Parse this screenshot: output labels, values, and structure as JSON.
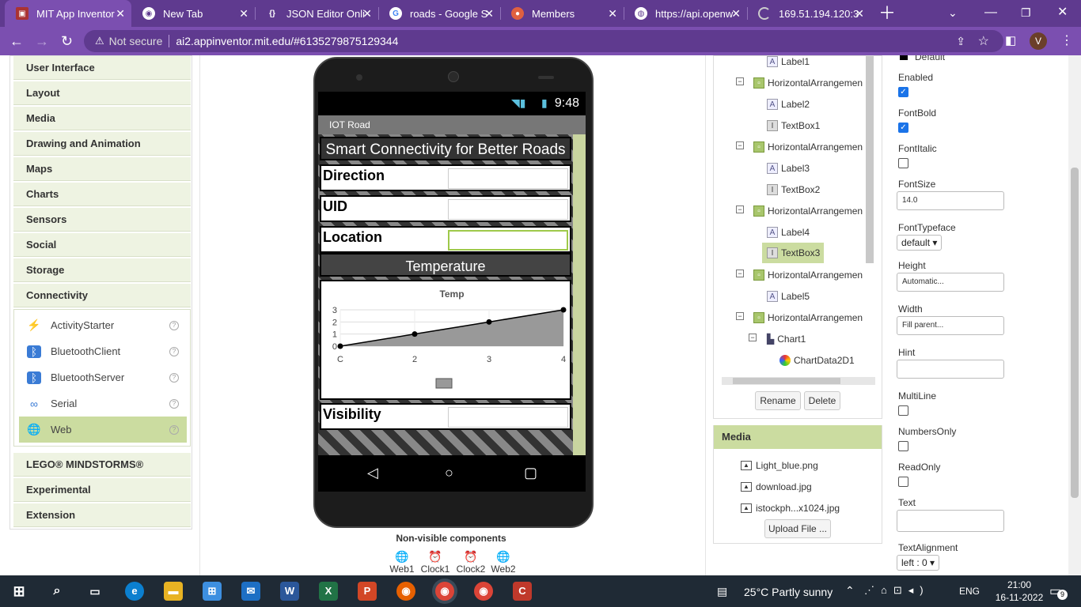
{
  "browser": {
    "tabs": [
      {
        "label": "MIT App Inventor",
        "active": true
      },
      {
        "label": "New Tab"
      },
      {
        "label": "JSON Editor Onli"
      },
      {
        "label": "roads - Google S"
      },
      {
        "label": "Members"
      },
      {
        "label": "https://api.openw"
      },
      {
        "label": "169.51.194.120:3"
      }
    ],
    "address": {
      "not_secure": "Not secure",
      "url": "ai2.appinventor.mit.edu/#6135279875129344"
    },
    "profile_initial": "V",
    "accent": "#7b4fb0"
  },
  "palette": {
    "categories": [
      "User Interface",
      "Layout",
      "Media",
      "Drawing and Animation",
      "Maps",
      "Charts",
      "Sensors",
      "Social",
      "Storage",
      "Connectivity"
    ],
    "connectivity_items": [
      "ActivityStarter",
      "BluetoothClient",
      "BluetoothServer",
      "Serial",
      "Web"
    ],
    "bottom_categories": [
      "LEGO® MINDSTORMS®",
      "Experimental",
      "Extension"
    ]
  },
  "phone": {
    "status_time": "9:48",
    "screen_title": "IOT Road",
    "app_title": "Smart Connectivity for Better Roads",
    "labels": {
      "direction": "Direction",
      "uid": "UID",
      "location": "Location",
      "temperature": "Temperature",
      "visibility": "Visibility"
    }
  },
  "chart_data": {
    "type": "area",
    "title": "Temp",
    "x": [
      "C",
      "2",
      "3",
      "4"
    ],
    "values": [
      0,
      1,
      2,
      3
    ],
    "yticks": [
      "0",
      "1",
      "2",
      "3"
    ],
    "ylim": [
      0,
      3
    ],
    "grid": true,
    "fill": "#999999"
  },
  "nonvisible": {
    "title": "Non-visible components",
    "items": [
      "Web1",
      "Clock1",
      "Clock2",
      "Web2"
    ]
  },
  "tree": {
    "nodes": [
      {
        "label": "Label1"
      },
      {
        "label": "HorizontalArrangemen"
      },
      {
        "label": "Label2"
      },
      {
        "label": "TextBox1"
      },
      {
        "label": "HorizontalArrangemen"
      },
      {
        "label": "Label3"
      },
      {
        "label": "TextBox2"
      },
      {
        "label": "HorizontalArrangemen"
      },
      {
        "label": "Label4"
      },
      {
        "label": "TextBox3"
      },
      {
        "label": "HorizontalArrangemen"
      },
      {
        "label": "Label5"
      },
      {
        "label": "HorizontalArrangemen"
      },
      {
        "label": "Chart1"
      },
      {
        "label": "ChartData2D1"
      }
    ],
    "rename": "Rename",
    "delete": "Delete"
  },
  "media": {
    "title": "Media",
    "files": [
      "Light_blue.png",
      "download.jpg",
      "istockph...x1024.jpg"
    ],
    "upload": "Upload File ..."
  },
  "properties": {
    "default_label": "Default",
    "enabled": "Enabled",
    "fontbold": "FontBold",
    "fontitalic": "FontItalic",
    "fontsize": "FontSize",
    "fontsize_value": "14.0",
    "fonttypeface": "FontTypeface",
    "fonttypeface_value": "default ▾",
    "height": "Height",
    "height_value": "Automatic...",
    "width": "Width",
    "width_value": "Fill parent...",
    "hint": "Hint",
    "multiline": "MultiLine",
    "numbersonly": "NumbersOnly",
    "readonly": "ReadOnly",
    "text": "Text",
    "textalignment": "TextAlignment",
    "textalignment_value": "left : 0 ▾"
  },
  "taskbar": {
    "weather_temp": "25°C",
    "weather_desc": "Partly sunny",
    "lang": "ENG",
    "time": "21:00",
    "date": "16-11-2022",
    "notif_count": "9"
  }
}
